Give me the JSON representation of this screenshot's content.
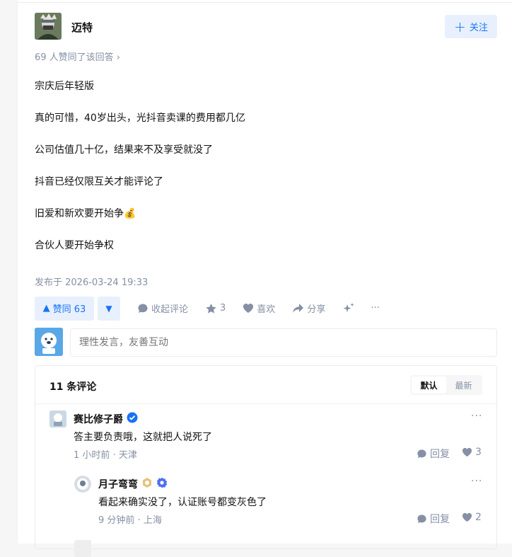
{
  "author": {
    "name": "迈特",
    "follow_label": "关注"
  },
  "voters_text": "69 人赞同了该回答 ›",
  "content_lines": [
    "宗庆后年轻版",
    "真的可惜，40岁出头，光抖音卖课的费用都几亿",
    "公司估值几十亿，结果来不及享受就没了",
    "抖音已经仅限互关才能评论了",
    "旧爱和新欢要开始争💰",
    "合伙人要开始争权"
  ],
  "published": "发布于 2026-03-24 19:33",
  "actions": {
    "upvote_label": "赞同 63",
    "collapse_comments": "收起评论",
    "star_count": "3",
    "like_label": "喜欢",
    "share_label": "分享",
    "more": "···"
  },
  "comment_input": {
    "placeholder": "理性发言，友善互动"
  },
  "comments": {
    "count_label": "11 条评论",
    "sort": {
      "default": "默认",
      "latest": "最新"
    },
    "items": [
      {
        "name": "赛比修子爵",
        "text": "答主要负责哦，这就把人说死了",
        "time": "1 小时前",
        "location": "天津",
        "reply_label": "回复",
        "likes": "3"
      },
      {
        "name": "月子弯弯",
        "text": "看起来确实没了，认证账号都变灰色了",
        "time": "9 分钟前",
        "location": "上海",
        "reply_label": "回复",
        "likes": "2"
      }
    ]
  },
  "colors": {
    "accent": "#1772f6",
    "muted": "#8590a6",
    "vote_bg": "#e8f0fd"
  },
  "icons": [
    "plus-icon",
    "triangle-up-icon",
    "triangle-down-icon",
    "comment-icon",
    "star-icon",
    "heart-icon",
    "share-icon",
    "sparkle-icon",
    "more-icon",
    "verified-icon",
    "badge-icon"
  ]
}
